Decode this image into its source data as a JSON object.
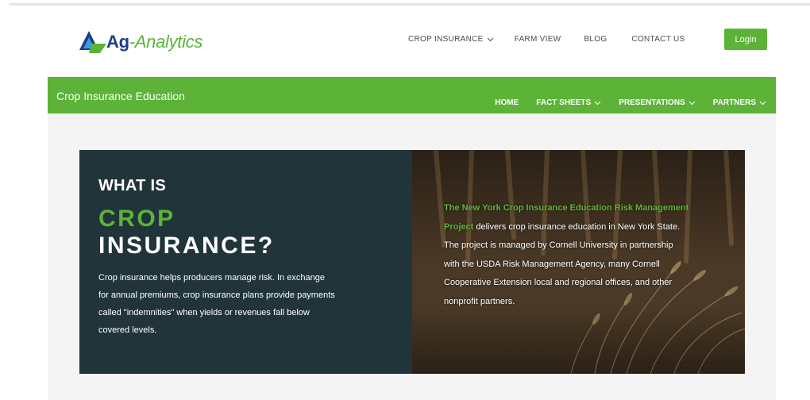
{
  "header": {
    "logo": {
      "ag": "Ag",
      "rest": "-Analytics"
    },
    "nav": [
      {
        "label": "CROP INSURANCE",
        "dropdown": true
      },
      {
        "label": "FARM VIEW",
        "dropdown": false
      },
      {
        "label": "BLOG",
        "dropdown": false
      },
      {
        "label": "CONTACT US",
        "dropdown": false
      }
    ],
    "login_label": "Login"
  },
  "subbar": {
    "title": "Crop Insurance Education",
    "nav": [
      {
        "label": "HOME",
        "dropdown": false
      },
      {
        "label": "FACT SHEETS",
        "dropdown": true
      },
      {
        "label": "PRESENTATIONS",
        "dropdown": true
      },
      {
        "label": "PARTNERS",
        "dropdown": true
      }
    ]
  },
  "hero": {
    "heading_line1": "WHAT IS",
    "heading_line2": "CROP",
    "heading_line3": "INSURANCE?",
    "description": "Crop insurance helps producers manage risk. In exchange for annual premiums, crop insurance plans provide payments called \"indemnities\" when yields or revenues fall below covered levels.",
    "right_highlight": "The New York Crop Insurance Education Risk Management Project",
    "right_text": " delivers crop insurance education in New York State. The project is managed by Cornell University in partnership with the USDA Risk Management Agency, many Cornell Cooperative Extension local and regional offices, and other nonprofit partners."
  },
  "colors": {
    "brand_green": "#5cb338",
    "brand_blue": "#1c3d8a",
    "hero_dark": "#21343a"
  }
}
